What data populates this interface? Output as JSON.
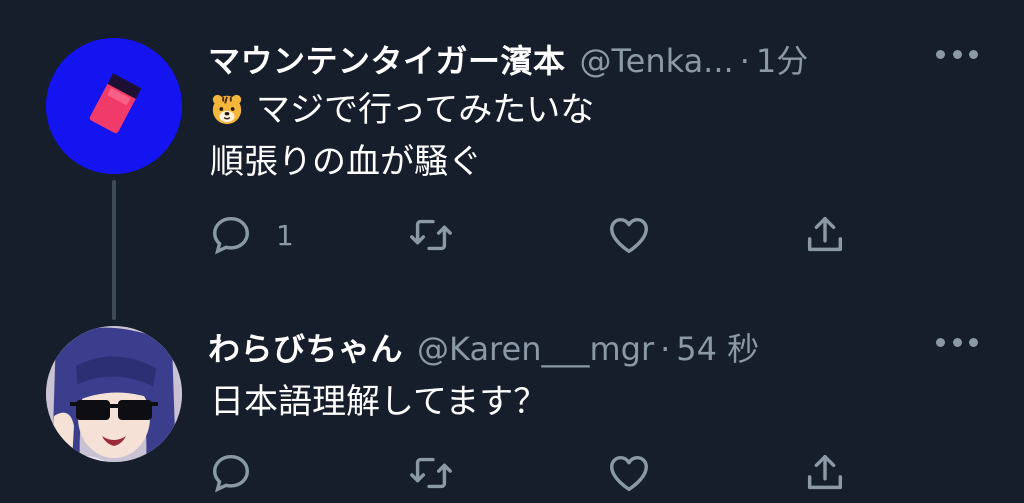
{
  "tweets": [
    {
      "display_name": "マウンテンタイガー濱本",
      "handle": "@Tenka...",
      "separator": "·",
      "time": "1分",
      "lines": [
        "マジで行ってみたいな",
        "順張りの血が騒ぐ"
      ],
      "emoji": "tiger-face-icon",
      "reply_count": "1",
      "avatar_color": "#1414f0"
    },
    {
      "display_name": "わらびちゃん",
      "handle": "@Karen___mgr",
      "separator": "·",
      "time": "54 秒",
      "lines": [
        "日本語理解してます？"
      ],
      "reply_count": "",
      "avatar_color": "#c9c2d2"
    }
  ],
  "colors": {
    "background": "#151e2a",
    "text": "#ffffff",
    "secondary": "#8b98a5",
    "thread_line": "#3f4a58"
  },
  "icons": {
    "reply": "reply-icon",
    "retweet": "retweet-icon",
    "like": "heart-icon",
    "share": "share-icon",
    "more": "more-icon"
  }
}
